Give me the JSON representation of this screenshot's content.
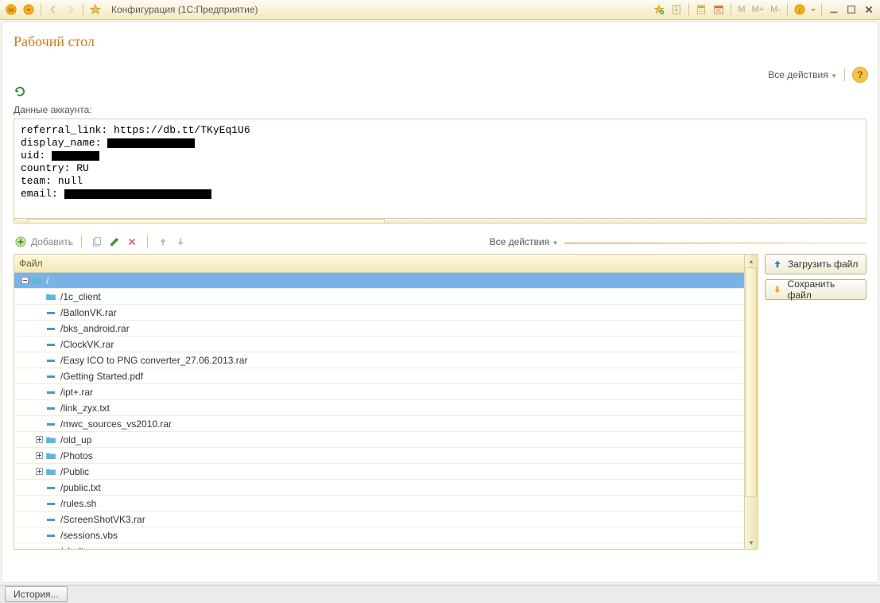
{
  "titlebar": {
    "app_title": "Конфигурация  (1С:Предприятие)"
  },
  "page": {
    "title": "Рабочий стол",
    "all_actions": "Все действия",
    "account_label": "Данные аккаунта:"
  },
  "account": {
    "referral_label": "referral_link:",
    "referral_value": " https://db.tt/TKyEq1U6",
    "display_name_label": "display_name:",
    "uid_label": "uid:",
    "country_label": "country:",
    "country_value": " RU",
    "team_label": "team:",
    "team_value": " null",
    "email_label": "email:"
  },
  "toolbar2": {
    "add_label": "Добавить",
    "all_actions": "Все действия"
  },
  "tree": {
    "header": "Файл",
    "root": "/",
    "rows": [
      {
        "kind": "folder",
        "name": "/1c_client",
        "exp": false,
        "depth": 1
      },
      {
        "kind": "file",
        "name": "/BallonVK.rar",
        "depth": 1
      },
      {
        "kind": "file",
        "name": "/bks_android.rar",
        "depth": 1
      },
      {
        "kind": "file",
        "name": "/ClockVK.rar",
        "depth": 1
      },
      {
        "kind": "file",
        "name": "/Easy ICO to PNG converter_27.06.2013.rar",
        "depth": 1
      },
      {
        "kind": "file",
        "name": "/Getting Started.pdf",
        "depth": 1
      },
      {
        "kind": "file",
        "name": "/ipt+.rar",
        "depth": 1
      },
      {
        "kind": "file",
        "name": "/link_zyx.txt",
        "depth": 1
      },
      {
        "kind": "file",
        "name": "/mwc_sources_vs2010.rar",
        "depth": 1
      },
      {
        "kind": "folder",
        "name": "/old_up",
        "exp": false,
        "depth": 1,
        "toggle": true
      },
      {
        "kind": "folder",
        "name": "/Photos",
        "exp": false,
        "depth": 1,
        "toggle": true
      },
      {
        "kind": "folder",
        "name": "/Public",
        "exp": false,
        "depth": 1,
        "toggle": true
      },
      {
        "kind": "file",
        "name": "/public.txt",
        "depth": 1
      },
      {
        "kind": "file",
        "name": "/rules.sh",
        "depth": 1
      },
      {
        "kind": "file",
        "name": "/ScreenShotVK3.rar",
        "depth": 1
      },
      {
        "kind": "file",
        "name": "/sessions.vbs",
        "depth": 1
      },
      {
        "kind": "file",
        "name": "/sh.dt",
        "depth": 1
      }
    ]
  },
  "side": {
    "upload": "Загрузить файл",
    "save": "Сохранить файл"
  },
  "footer": {
    "history": "История..."
  },
  "m_labels": {
    "m": "M",
    "mp": "M+",
    "mm": "M-"
  }
}
